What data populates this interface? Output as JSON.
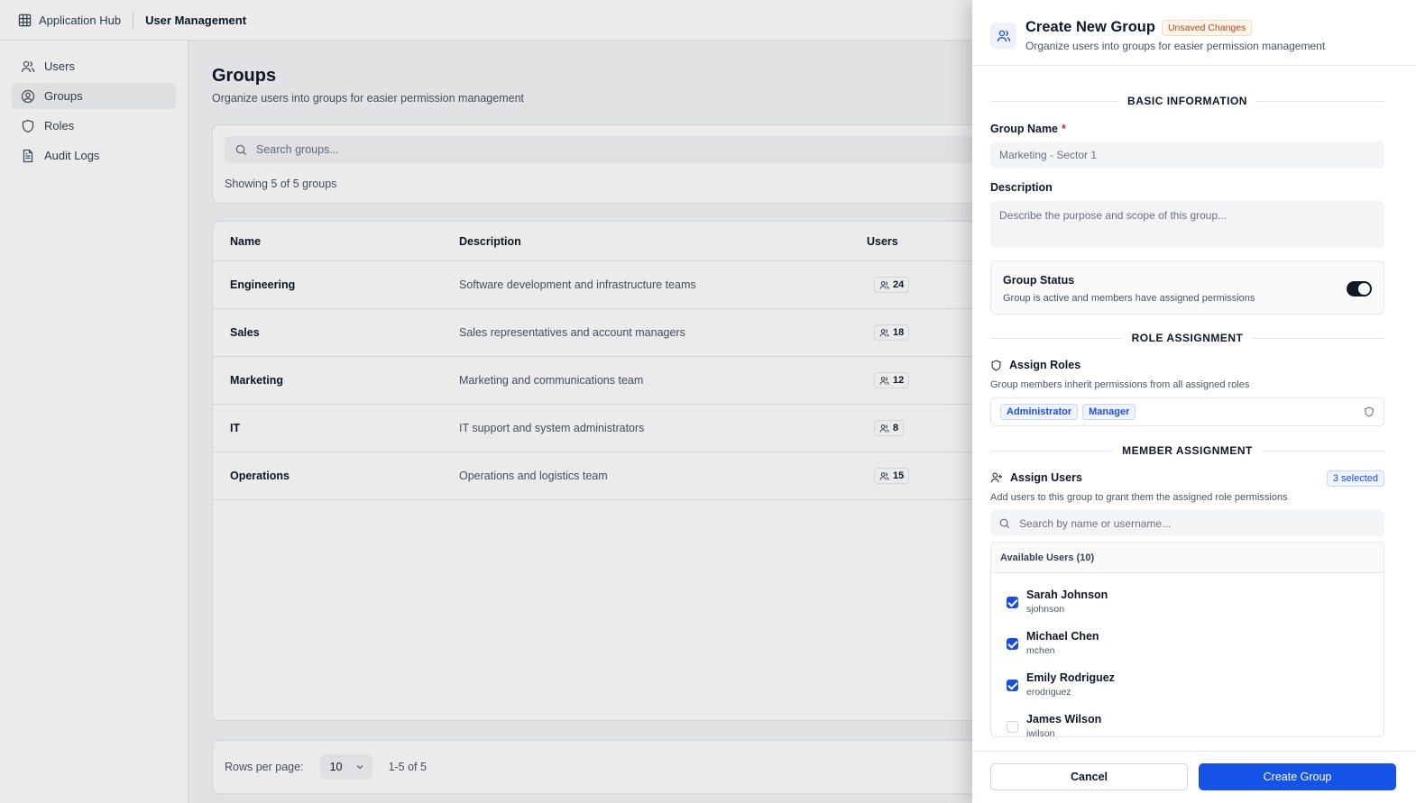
{
  "topbar": {
    "app_name": "Application Hub",
    "section": "User Management",
    "icons": {
      "app": "grid-icon"
    }
  },
  "sidebar": {
    "items": [
      {
        "label": "Users",
        "icon": "users-icon",
        "active": false
      },
      {
        "label": "Groups",
        "icon": "user-circle-icon",
        "active": true
      },
      {
        "label": "Roles",
        "icon": "shield-icon",
        "active": false
      },
      {
        "label": "Audit Logs",
        "icon": "document-icon",
        "active": false
      }
    ]
  },
  "page": {
    "title": "Groups",
    "subtitle": "Organize users into groups for easier permission management",
    "search_placeholder": "Search groups...",
    "showing": "Showing 5 of 5 groups"
  },
  "table": {
    "columns": [
      "Name",
      "Description",
      "Users"
    ],
    "rows": [
      {
        "name": "Engineering",
        "description": "Software development and infrastructure teams",
        "users": "24"
      },
      {
        "name": "Sales",
        "description": "Sales representatives and account managers",
        "users": "18"
      },
      {
        "name": "Marketing",
        "description": "Marketing and communications team",
        "users": "12"
      },
      {
        "name": "IT",
        "description": "IT support and system administrators",
        "users": "8"
      },
      {
        "name": "Operations",
        "description": "Operations and logistics team",
        "users": "15"
      }
    ]
  },
  "pagination": {
    "rows_per_page_label": "Rows per page:",
    "rows_per_page": "10",
    "range": "1-5 of 5"
  },
  "drawer": {
    "title": "Create New Group",
    "badge": "Unsaved Changes",
    "subtitle": "Organize users into groups for easier permission management",
    "basic_section": "BASIC INFORMATION",
    "group_name_label": "Group Name",
    "group_name_required": "*",
    "group_name_value": "Marketing - Sector 1",
    "description_label": "Description",
    "description_placeholder": "Describe the purpose and scope of this group...",
    "status_title": "Group Status",
    "status_desc": "Group is active and members have assigned permissions",
    "status_on": true,
    "role_section": "ROLE ASSIGNMENT",
    "assign_roles_label": "Assign Roles",
    "assign_roles_hint": "Group members inherit permissions from all assigned roles",
    "roles": [
      "Administrator",
      "Manager"
    ],
    "member_section": "MEMBER ASSIGNMENT",
    "assign_users_label": "Assign Users",
    "selected_badge": "3 selected",
    "assign_users_hint": "Add users to this group to grant them the assigned role permissions",
    "user_search_placeholder": "Search by name or username...",
    "available_label": "Available Users (10)",
    "users": [
      {
        "name": "Sarah Johnson",
        "username": "sjohnson",
        "checked": true
      },
      {
        "name": "Michael Chen",
        "username": "mchen",
        "checked": true
      },
      {
        "name": "Emily Rodriguez",
        "username": "erodriguez",
        "checked": true
      },
      {
        "name": "James Wilson",
        "username": "jwilson",
        "checked": false
      }
    ],
    "cancel_label": "Cancel",
    "create_label": "Create Group"
  },
  "colors": {
    "primary": "#1552e6",
    "badge_orange": "#c2410c",
    "chip_blue": "#1d4ed8"
  }
}
